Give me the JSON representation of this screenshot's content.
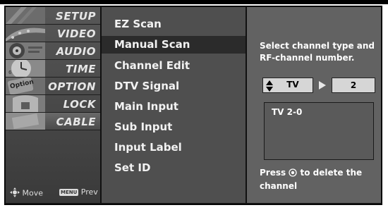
{
  "sidebar": {
    "items": [
      {
        "label": "SETUP",
        "icon": "setup-thumbnail"
      },
      {
        "label": "VIDEO",
        "icon": "video-thumbnail"
      },
      {
        "label": "AUDIO",
        "icon": "audio-thumbnail"
      },
      {
        "label": "TIME",
        "icon": "time-thumbnail"
      },
      {
        "label": "OPTION",
        "icon": "option-thumbnail",
        "badge": "Option"
      },
      {
        "label": "LOCK",
        "icon": "lock-thumbnail"
      },
      {
        "label": "CABLE",
        "icon": "cable-thumbnail"
      }
    ],
    "hints": {
      "move_label": "Move",
      "prev_key": "MENU",
      "prev_label": "Prev"
    }
  },
  "submenu": {
    "items": [
      {
        "label": "EZ Scan"
      },
      {
        "label": "Manual Scan"
      },
      {
        "label": "Channel Edit"
      },
      {
        "label": "DTV Signal"
      },
      {
        "label": "Main Input"
      },
      {
        "label": "Sub Input"
      },
      {
        "label": "Input Label"
      },
      {
        "label": "Set ID"
      }
    ],
    "selected_index": 1
  },
  "panel": {
    "description": "Select channel type and RF-channel number.",
    "channel_type": "TV",
    "channel_number": "2",
    "list_items": [
      "TV 2-0"
    ],
    "press_prefix": "Press",
    "press_suffix": "to delete the channel"
  },
  "colors": {
    "background": "#ffffff",
    "sidebar": "#4a4a4a",
    "submenu": "#4f4f4f",
    "submenu_selected": "#2b2b2b",
    "panel": "#626262",
    "input_box": "#d6d6d6"
  }
}
